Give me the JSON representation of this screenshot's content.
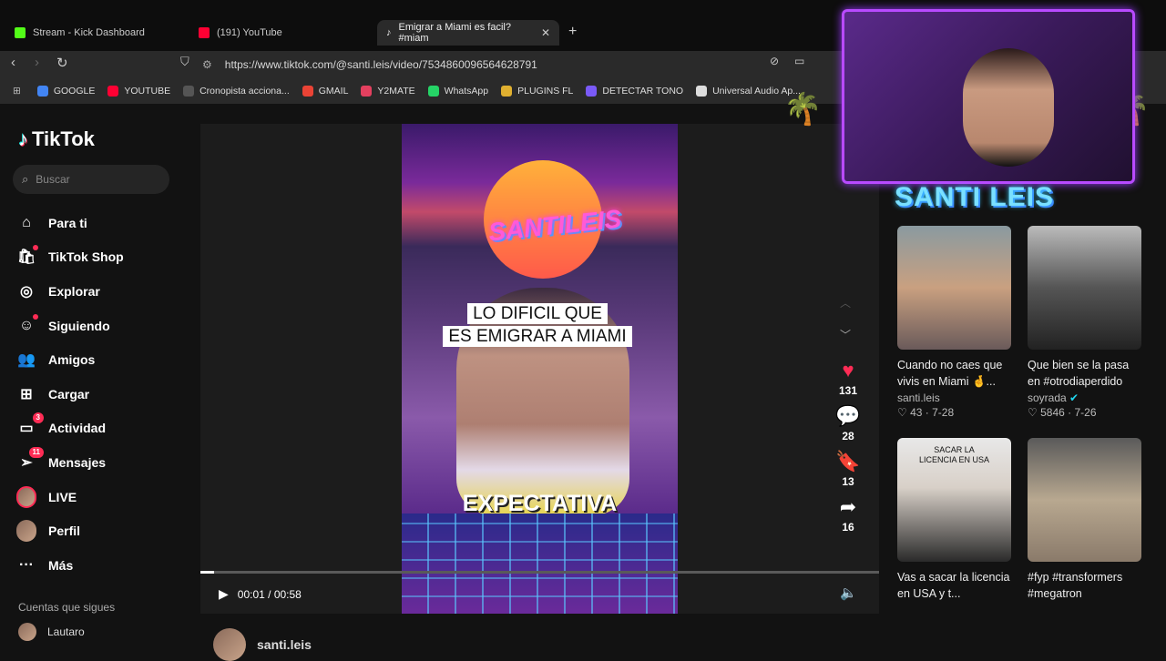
{
  "browser": {
    "tabs": [
      {
        "label": "Stream - Kick Dashboard",
        "color": "#53fc18"
      },
      {
        "label": "(191) YouTube",
        "color": "#ff0033"
      },
      {
        "label": "Emigrar a Miami es facil? #miam",
        "color": "#ffffff"
      }
    ],
    "close_label": "✕",
    "new_tab_label": "+",
    "url": "https://www.tiktok.com/@santi.leis/video/7534860096564628791",
    "bookmarks": [
      {
        "label": "GOOGLE",
        "color": "#4285f4"
      },
      {
        "label": "YOUTUBE",
        "color": "#ff0033"
      },
      {
        "label": "Cronopista acciona...",
        "color": "#555555"
      },
      {
        "label": "GMAIL",
        "color": "#ea4335"
      },
      {
        "label": "Y2MATE",
        "color": "#e4405f"
      },
      {
        "label": "WhatsApp",
        "color": "#25d366"
      },
      {
        "label": "PLUGINS FL",
        "color": "#e0b030"
      },
      {
        "label": "DETECTAR TONO",
        "color": "#7a5af8"
      },
      {
        "label": "Universal Audio Ap...",
        "color": "#dddddd"
      }
    ]
  },
  "sidebar": {
    "logo": "TikTok",
    "search_placeholder": "Buscar",
    "items": [
      {
        "label": "Para ti",
        "icon": "⌂"
      },
      {
        "label": "TikTok Shop",
        "icon": "🛍"
      },
      {
        "label": "Explorar",
        "icon": "◎"
      },
      {
        "label": "Siguiendo",
        "icon": "☺"
      },
      {
        "label": "Amigos",
        "icon": "👥"
      },
      {
        "label": "Cargar",
        "icon": "⊞"
      },
      {
        "label": "Actividad",
        "icon": "▭",
        "badge": "3"
      },
      {
        "label": "Mensajes",
        "icon": "➢",
        "badge": "11"
      },
      {
        "label": "LIVE",
        "icon": "live"
      },
      {
        "label": "Perfil",
        "icon": "profile"
      },
      {
        "label": "Más",
        "icon": "···"
      }
    ],
    "following_title": "Cuentas que sigues",
    "following_user": "Lautaro"
  },
  "player": {
    "caption_line1": "LO DIFICIL QUE",
    "caption_line2": "ES EMIGRAR A MIAMI",
    "brand": "SANTILEIS",
    "overlay_text": "EXPECTATIVA",
    "time": "00:01 / 00:58",
    "progress": 0.02,
    "author": "santi.leis"
  },
  "actions": [
    {
      "icon": "♥",
      "count": "131",
      "color": "#fe2c55"
    },
    {
      "icon": "💬",
      "count": "28",
      "color": "#ffffff"
    },
    {
      "icon": "🔖",
      "count": "13",
      "color": "#fac328"
    },
    {
      "icon": "➦",
      "count": "16",
      "color": "#ffffff"
    }
  ],
  "webcam": {
    "name": "SANTI LEIS"
  },
  "related": [
    {
      "title": "Cuando no caes que vivis en Miami 🤞...",
      "user": "santi.leis",
      "likes": "43",
      "date": "7-28",
      "verified": false
    },
    {
      "title": "Que bien se la pasa en #otrodiaperdido",
      "user": "soyrada",
      "likes": "5846",
      "date": "7-26",
      "verified": true
    },
    {
      "title": "Vas a sacar la licencia en USA y t...",
      "user": "",
      "likes": "",
      "date": "",
      "verified": false,
      "thumb_text": "SACAR LA LICENCIA EN USA"
    },
    {
      "title": "#fyp #transformers #megatron",
      "user": "",
      "likes": "",
      "date": "",
      "verified": false
    }
  ]
}
